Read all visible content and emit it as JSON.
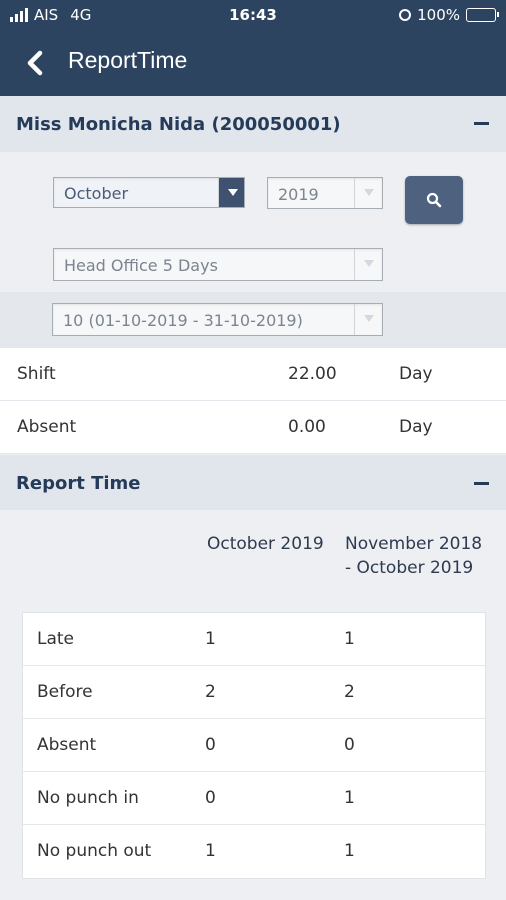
{
  "status_bar": {
    "carrier": "AIS",
    "network": "4G",
    "time": "16:43",
    "battery": "100%"
  },
  "header": {
    "title": "ReportTime"
  },
  "employee": {
    "name": "Miss Monicha Nida (200050001)"
  },
  "filters": {
    "month": "October",
    "year": "2019",
    "shift_group": "Head Office 5 Days",
    "period": "10 (01-10-2019 - 31-10-2019)"
  },
  "summary": [
    {
      "label": "Shift",
      "value": "22.00",
      "unit": "Day"
    },
    {
      "label": "Absent",
      "value": "0.00",
      "unit": "Day"
    }
  ],
  "report": {
    "title": "Report Time",
    "columns": [
      "October 2019",
      "November 2018 - October 2019"
    ],
    "rows": [
      {
        "label": "Late",
        "month": "1",
        "year": "1"
      },
      {
        "label": "Before",
        "month": "2",
        "year": "2"
      },
      {
        "label": "Absent",
        "month": "0",
        "year": "0"
      },
      {
        "label": "No punch in",
        "month": "0",
        "year": "1"
      },
      {
        "label": "No punch out",
        "month": "1",
        "year": "1"
      }
    ]
  }
}
